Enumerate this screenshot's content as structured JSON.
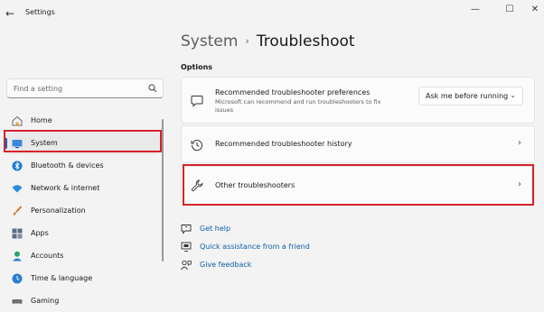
{
  "window": {
    "title": "Settings",
    "minimize": "—",
    "maximize": "☐",
    "close": "✕",
    "back": "←"
  },
  "search": {
    "placeholder": "Find a setting"
  },
  "sidebar": {
    "items": [
      {
        "label": "Home"
      },
      {
        "label": "System"
      },
      {
        "label": "Bluetooth & devices"
      },
      {
        "label": "Network & internet"
      },
      {
        "label": "Personalization"
      },
      {
        "label": "Apps"
      },
      {
        "label": "Accounts"
      },
      {
        "label": "Time & language"
      },
      {
        "label": "Gaming"
      }
    ]
  },
  "breadcrumb": {
    "parent": "System",
    "separator": "›",
    "current": "Troubleshoot"
  },
  "options_heading": "Options",
  "cards": {
    "preferences": {
      "title": "Recommended troubleshooter preferences",
      "subtitle": "Microsoft can recommend and run troubleshooters to fix issues",
      "dropdown_value": "Ask me before running",
      "dropdown_chevron": "⌄"
    },
    "history": {
      "title": "Recommended troubleshooter history",
      "chevron": "›"
    },
    "other": {
      "title": "Other troubleshooters",
      "chevron": "›"
    }
  },
  "links": {
    "help": "Get help",
    "assist": "Quick assistance from a friend",
    "feedback": "Give feedback"
  },
  "colors": {
    "accent": "#0067c0",
    "highlight": "#d4232a",
    "link": "#0d5fa8"
  }
}
